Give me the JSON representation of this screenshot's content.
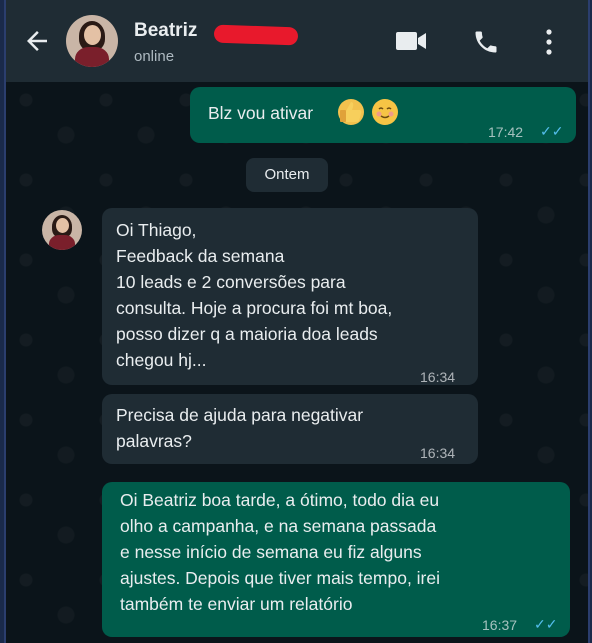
{
  "header": {
    "contact_name": "Beatriz",
    "status": "online",
    "icons": [
      "back-arrow-icon",
      "video-call-icon",
      "phone-icon",
      "more-vert-icon"
    ]
  },
  "messages": [
    {
      "direction": "outgoing",
      "text": "Blz vou ativar",
      "emojis": [
        "thumbs-up",
        "smiling-face"
      ],
      "time": "17:42",
      "read": true
    },
    {
      "direction": "incoming",
      "text": "Oi Thiago,\nFeedback da semana\n10 leads e 2 conversões para\nconsulta. Hoje a procura foi mt boa,\nposso dizer q a maioria doa leads\nchegou hj...",
      "time": "16:34"
    },
    {
      "direction": "incoming",
      "text": "Precisa de ajuda para negativar\npalavras?",
      "time": "16:34"
    },
    {
      "direction": "outgoing",
      "text": "Oi Beatriz boa tarde,  a ótimo, todo dia eu\nolho a campanha,  e na semana passada\ne nesse início de semana eu fiz alguns\najustes. Depois que tiver mais tempo,  irei\ntambém te enviar um relatório",
      "time": "16:37",
      "read": true
    }
  ],
  "date_separator": "Ontem",
  "colors": {
    "background": "#0b141a",
    "header": "#1f2c34",
    "outgoing_bubble": "#005c4b",
    "incoming_bubble": "#1f2c34",
    "read_ticks": "#53bdeb",
    "redaction": "#e8192c"
  }
}
